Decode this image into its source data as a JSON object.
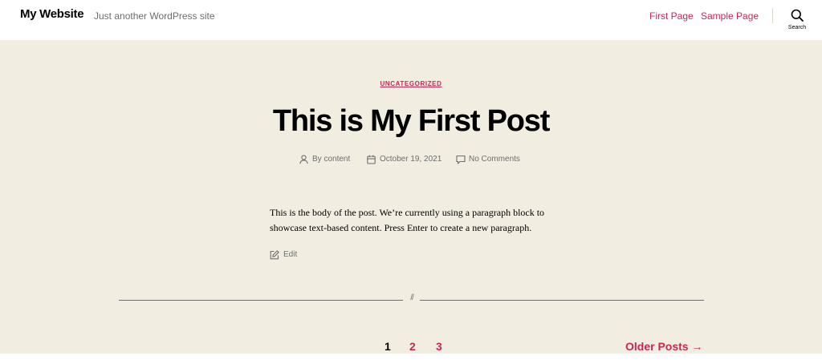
{
  "header": {
    "site_title": "My Website",
    "tagline": "Just another WordPress site",
    "nav": [
      {
        "label": "First Page"
      },
      {
        "label": "Sample Page"
      }
    ],
    "search_label": "Search",
    "search_icon": "search-icon"
  },
  "post": {
    "category": "UNCATEGORIZED",
    "title": "This is My First Post",
    "meta": {
      "author": "By content",
      "date": "October 19, 2021",
      "comments": "No Comments"
    },
    "body": "This is the body of the post. We’re currently using a paragraph block to showcase text-based content. Press Enter to create a new paragraph.",
    "edit_label": "Edit"
  },
  "divider": {
    "mark": "//"
  },
  "pagination": {
    "pages": [
      "1",
      "2",
      "3"
    ],
    "current": "1",
    "older_label": "Older Posts →"
  },
  "colors": {
    "accent": "#cd2653",
    "background": "#f1ede0",
    "header_bg": "#ffffff",
    "meta_text": "#6d6d6d"
  }
}
